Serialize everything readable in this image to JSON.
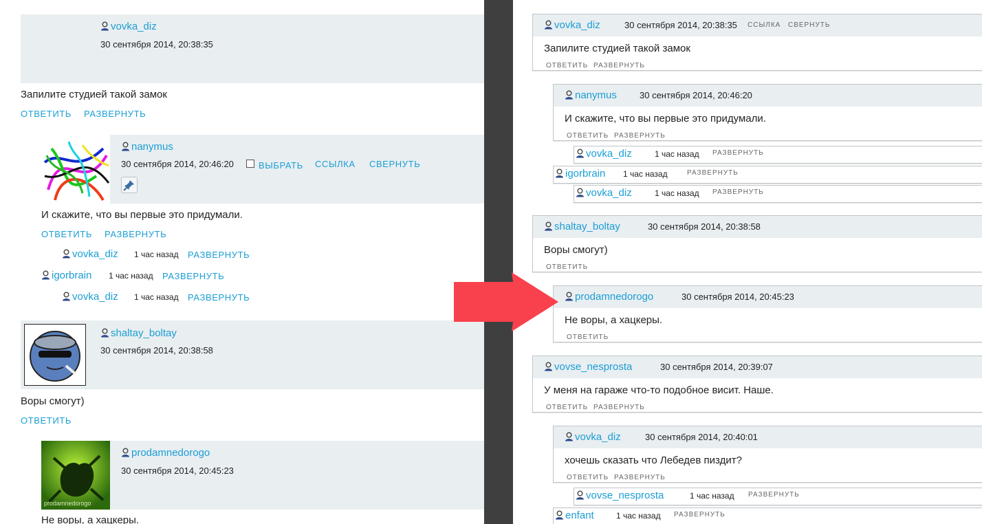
{
  "colors": {
    "link": "#1a9ed4",
    "header_bg": "#e9eef1",
    "divider": "#3f3f3f",
    "arrow": "#f9414d"
  },
  "left": {
    "c1": {
      "user": "vovka_diz",
      "date": "30 сентября 2014, 20:38:35",
      "text": "Запилите студией такой замок",
      "reply": "ОТВЕТИТЬ",
      "expand": "РАЗВЕРНУТЬ"
    },
    "c2": {
      "user": "nanymus",
      "date": "30 сентября 2014, 20:46:20",
      "select": "ВЫБРАТЬ",
      "link": "ССЫЛКА",
      "collapse": "СВЕРНУТЬ",
      "text": "И скажите, что вы первые это придумали.",
      "reply": "ОТВЕТИТЬ",
      "expand": "РАЗВЕРНУТЬ"
    },
    "c2_sub1": {
      "user": "vovka_diz",
      "time": "1 час назад",
      "expand": "РАЗВЕРНУТЬ"
    },
    "c2_sub2": {
      "user": "igorbrain",
      "time": "1 час назад",
      "expand": "РАЗВЕРНУТЬ"
    },
    "c2_sub3": {
      "user": "vovka_diz",
      "time": "1 час назад",
      "expand": "РАЗВЕРНУТЬ"
    },
    "c3": {
      "user": "shaltay_boltay",
      "date": "30 сентября 2014, 20:38:58",
      "text": "Воры смогут)",
      "reply": "ОТВЕТИТЬ"
    },
    "c4": {
      "user": "prodamnedorogo",
      "date": "30 сентября 2014, 20:45:23",
      "text": "Не воры, а хацкеры.",
      "avatar_caption": "prodamnedorogo"
    }
  },
  "right": {
    "c1": {
      "user": "vovka_diz",
      "date": "30 сентября 2014, 20:38:35",
      "link": "ССЫЛКА",
      "collapse": "СВЕРНУТЬ",
      "text": "Запилите студией такой замок",
      "reply": "ОТВЕТИТЬ",
      "expand": "РАЗВЕРНУТЬ"
    },
    "c2": {
      "user": "nanymus",
      "date": "30 сентября 2014, 20:46:20",
      "text": "И скажите, что вы первые это придумали.",
      "reply": "ОТВЕТИТЬ",
      "expand": "РАЗВЕРНУТЬ"
    },
    "c2_sub1": {
      "user": "vovka_diz",
      "time": "1 час назад",
      "expand": "РАЗВЕРНУТЬ"
    },
    "c2_sub2": {
      "user": "igorbrain",
      "time": "1 час назад",
      "expand": "РАЗВЕРНУТЬ"
    },
    "c2_sub3": {
      "user": "vovka_diz",
      "time": "1 час назад",
      "expand": "РАЗВЕРНУТЬ"
    },
    "c3": {
      "user": "shaltay_boltay",
      "date": "30 сентября 2014, 20:38:58",
      "text": "Воры смогут)",
      "reply": "ОТВЕТИТЬ"
    },
    "c4": {
      "user": "prodamnedorogo",
      "date": "30 сентября 2014, 20:45:23",
      "text": "Не воры, а хацкеры.",
      "reply": "ОТВЕТИТЬ"
    },
    "c5": {
      "user": "vovse_nesprosta",
      "date": "30 сентября 2014, 20:39:07",
      "text": "У меня на гараже что-то подобное висит. Наше.",
      "reply": "ОТВЕТИТЬ",
      "expand": "РАЗВЕРНУТЬ"
    },
    "c6": {
      "user": "vovka_diz",
      "date": "30 сентября 2014, 20:40:01",
      "text": "хочешь сказать что Лебедев пиздит?",
      "reply": "ОТВЕТИТЬ",
      "expand": "РАЗВЕРНУТЬ"
    },
    "c6_sub1": {
      "user": "vovse_nesprosta",
      "time": "1 час назад",
      "expand": "РАЗВЕРНУТЬ"
    },
    "c6_sub2": {
      "user": "enfant",
      "time": "1 час назад",
      "expand": "РАЗВЕРНУТЬ"
    }
  }
}
